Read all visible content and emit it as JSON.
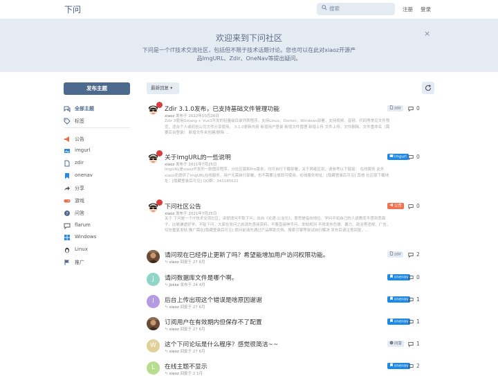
{
  "header": {
    "brand": "下问",
    "search_placeholder": "搜索",
    "register": "注册",
    "login": "登录"
  },
  "hero": {
    "title": "欢迎来到下问社区",
    "description": "下问是一个IT技术交流社区，包括但不限于技术话题讨论。您也可以在此对xiaoz开源产品ImgURL、Zdir、OneNav等提出疑问。",
    "close": "×"
  },
  "sidebar": {
    "new_discussion": "发布主题",
    "items": [
      {
        "label": "全部主题",
        "icon": "comments-icon",
        "active": true
      },
      {
        "label": "标签",
        "icon": "tags-icon"
      },
      {
        "label": "公告",
        "icon": "megaphone-icon"
      },
      {
        "label": "imgurl",
        "icon": "image-icon"
      },
      {
        "label": "zdir",
        "icon": "file-icon"
      },
      {
        "label": "onenav",
        "icon": "bookmark-icon"
      },
      {
        "label": "分享",
        "icon": "share-icon"
      },
      {
        "label": "游戏",
        "icon": "gamepad-icon"
      },
      {
        "label": "问答",
        "icon": "question-icon"
      },
      {
        "label": "flarum",
        "icon": "chat-icon"
      },
      {
        "label": "Windows",
        "icon": "windows-icon"
      },
      {
        "label": "Linux",
        "icon": "linux-icon"
      },
      {
        "label": "推广",
        "icon": "flag-icon"
      }
    ]
  },
  "toolbar": {
    "sort": "最新回复 ▾"
  },
  "discussions": [
    {
      "title": "Zdir 3.1.0发布，已支持基础文件管理功能",
      "author": "xiaoz",
      "meta": "发布于 2022年10月26日",
      "excerpt": "Zdir 3使用Golang + Vue3开发的轻量级目录列表程序，支持Linux、Docker、Windows部署，支持视频、音频、代码等常见文件预览，适合个人或初创公司文件分享使用。 3.1.0更新内容 新增用户登录 新增文件管理 新增上传 文件上传、文件删除、文件重命名（需要后台登录） 新增文件夹创建/删除 ...",
      "tag": "zdir",
      "tag_icon": "file-icon",
      "tag_style": "grey",
      "replies": "0",
      "avatar": "cartoon"
    },
    {
      "title": "关于ImgURL的一些说明",
      "author": "xiaoz",
      "meta": "发布于 2021年7月25日",
      "excerpt": "ImgURL是xiaoz开发的一款图床程序，分社区版和Pro版本，均可自行下载部署，关于两者区别，请参考以下链接： 在线服务 此外xiaoz还提供了ImgURL在线服务，用户无需自行部署，也不需要注册即可使用。在线服务地址：[隐藏登录后可见] 其他 社区版下载地址：[隐藏登录后可见] QQ群：341185621",
      "tag": "imgurl",
      "tag_icon": "image-icon",
      "tag_style": "blue",
      "replies": "0",
      "avatar": "cartoon"
    },
    {
      "title": "下问社区公告",
      "author": "xiaoz",
      "meta": "发布于 2021年7月25日",
      "excerpt": "关于 下问是一个IT技术交流社区，讲提提问不取下问，出自《论语·公冶长》，意思是指向地位、学问不如自己的人请教而不感到丢面子。比喻谦虚好学。不耻下问，大家在发问之前请先查阅资料，不要直接伸手问。发帖规则 不得发布色情、暴力、政治等违规、广告，切勿重复发帖 推广需在[隐藏登录后可见] 提问前请先通过产品帮助文档、搜索引擎等尝试自行解决 发布后请注意回复，…",
      "tag": "公告",
      "tag_icon": "megaphone-icon",
      "tag_style": "orange",
      "replies": "0",
      "avatar": "cartoon"
    },
    {
      "title": "请问现在已经停止更新了吗？希望能增加用户访问权限功能。",
      "author": "xiaoz",
      "meta": "回复于 27 6月",
      "tag": "zdir",
      "tag_icon": "file-icon",
      "tag_style": "grey",
      "replies": "2",
      "avatar": "photo"
    },
    {
      "title": "请问数据库文件是哪个啊。",
      "author": "Jokke",
      "meta": "发布于 24 4月",
      "tag": "onenav",
      "tag_icon": "bookmark-icon",
      "tag_style": "blue",
      "replies": "0",
      "avatar": "J",
      "avatar_color": "#8fd6c6"
    },
    {
      "title": "后台上传出现这个错误是啥原因谢谢",
      "author": "xiaoz",
      "meta": "回复于 27 6月",
      "tag": "onenav",
      "tag_icon": "bookmark-icon",
      "tag_style": "blue",
      "replies": "1",
      "avatar": "I",
      "avatar_color": "#b49ae0"
    },
    {
      "title": "订阅用户在有效期内但保存不了配置",
      "author": "xiaoz",
      "meta": "回复于 27 6月",
      "tag": "onenav",
      "tag_icon": "bookmark-icon",
      "tag_style": "blue",
      "replies": "1",
      "avatar": "photo"
    },
    {
      "title": "这个下问论坛是什么程序？感觉很简洁~~",
      "author": "xiaoz",
      "meta": "回复于 27 6月",
      "tag": "问答",
      "tag_icon": "question-icon",
      "tag_style": "grey",
      "replies": "1",
      "avatar": "W",
      "avatar_color": "#e0d199"
    },
    {
      "title": "在线主题不显示",
      "author": "xiaoz",
      "meta": "回复于 2 1月",
      "tag": "onenav",
      "tag_icon": "bookmark-icon",
      "tag_style": "blue",
      "replies": "2",
      "avatar": "L",
      "avatar_color": "#b8dd8e"
    }
  ],
  "colors": {
    "primary": "#4d698e",
    "hero_bg": "#e5ebf3",
    "tag_blue": "#1e88e5",
    "tag_orange": "#f0714b"
  }
}
